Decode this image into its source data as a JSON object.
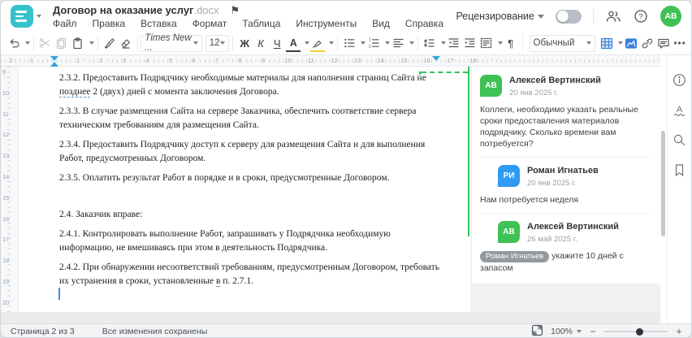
{
  "colors": {
    "teal": "#35c2ca",
    "green": "#3fc255",
    "blue_avatar": "#2f9bf4",
    "anchor_green": "#2fc45f",
    "icon_blue": "#3d7fd6"
  },
  "window": {
    "title": "Договор на оказание услуг",
    "title_ext": ".docx"
  },
  "menu": {
    "items": [
      "Файл",
      "Правка",
      "Вставка",
      "Формат",
      "Таблица",
      "Инструменты",
      "Вид",
      "Справка"
    ]
  },
  "topbar": {
    "review_label": "Рецензирование",
    "avatar_initials": "АВ"
  },
  "toolbar": {
    "font_name": "Times New ...",
    "font_size": "12",
    "bold": "Ж",
    "italic": "К",
    "underline": "Ч",
    "font_color": "А",
    "pilcrow": "¶",
    "style_name": "Обычный",
    "more": "•••"
  },
  "ruler": {
    "h_left": [
      "2",
      "1"
    ],
    "h_main": [
      "1",
      "2",
      "3",
      "4",
      "5",
      "6",
      "7",
      "8",
      "9",
      "10",
      "11",
      "12",
      "13",
      "14",
      "15",
      "16",
      "17",
      "18"
    ],
    "v": [
      "9",
      "10",
      "11",
      "12",
      "13",
      "14",
      "15",
      "16",
      "17",
      "18",
      "19",
      "20"
    ]
  },
  "document": {
    "p1": {
      "before": "2.3.2. Предоставить Подрядчику необходимые материалы для наполнения страниц Сайта не ",
      "underlined": "позднее",
      "after": " 2 (двух) дней с момента заключения Договора."
    },
    "p2": "2.3.3. В случае размещения Сайта на сервере Заказчика, обеспечить соответствие сервера техническим требованиям для размещения Сайта.",
    "p3": "2.3.4. Предоставить Подрядчику доступ к серверу для размещения Сайта и для выполнения Работ, предусмотренных Договором.",
    "p4": "2.3.5. Оплатить результат Работ в порядке и в сроки, предусмотренные Договором.",
    "p5": "2.4. Заказчик вправе:",
    "p6": "2.4.1. Контролировать выполнение Работ, запрашивать у Подрядчика необходимую информацию, не вмешиваясь при этом в деятельность Подрядчика.",
    "p7": {
      "before": "2.4.2. При обнаружении несоответствий требованиям, предусмотренным Договором, требовать их устранения в сроки, установленные ",
      "underlined": "в",
      "after": " п. 2.7.1."
    }
  },
  "comments": {
    "items": [
      {
        "initials": "АВ",
        "color": "#3fc255",
        "name": "Алексей Вертинский",
        "date": "20 янв 2025 г.",
        "text": "Коллеги, необходимо указать реальные сроки предоставления материалов подрядчику. Сколько времени вам потребуется?"
      },
      {
        "initials": "РИ",
        "color": "#2f9bf4",
        "name": "Роман Игнатьев",
        "date": "20 янв 2025 г.",
        "text": "Нам потребуется неделя"
      },
      {
        "initials": "АВ",
        "color": "#3fc255",
        "name": "Алексей Вертинский",
        "date": "26 май 2025 г.",
        "mention": "Роман Игнатьев",
        "text": " укажите 10 дней с запасом"
      }
    ]
  },
  "statusbar": {
    "page_info": "Страница 2 из 3",
    "saved_info": "Все изменения сохранены",
    "zoom_value": "100%"
  }
}
